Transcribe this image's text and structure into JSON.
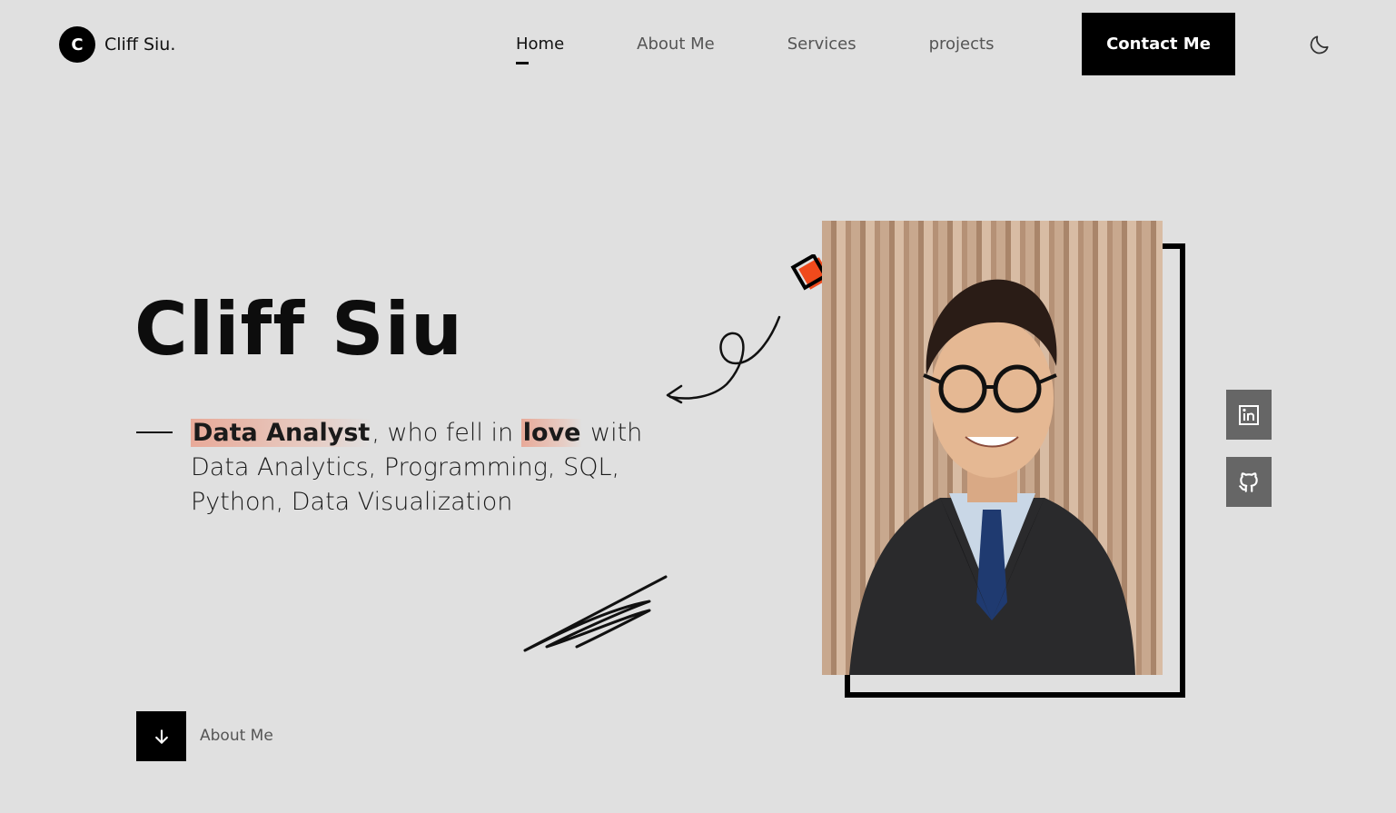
{
  "logo": {
    "initial": "C",
    "name": "Cliff Siu."
  },
  "nav": {
    "items": [
      {
        "label": "Home",
        "active": true
      },
      {
        "label": "About Me",
        "active": false
      },
      {
        "label": "Services",
        "active": false
      },
      {
        "label": "projects",
        "active": false
      }
    ],
    "contact_label": "Contact Me",
    "theme_icon": "moon-icon"
  },
  "hero": {
    "name": "Cliff Siu",
    "highlight_role": "Data Analyst",
    "text_after_role": ", who fell in ",
    "highlight_word": "love",
    "text_rest": " with Data Analytics, Programming, SQL, Python, Data Visualization"
  },
  "social": [
    {
      "icon": "linkedin-icon"
    },
    {
      "icon": "github-icon"
    }
  ],
  "scroll": {
    "icon": "arrow-down-icon",
    "label": "About Me"
  },
  "colors": {
    "background": "#e0e0e0",
    "primary": "#000000",
    "accent": "#f04a1c",
    "highlight": "#e9a08c",
    "social_bg": "#666666"
  }
}
